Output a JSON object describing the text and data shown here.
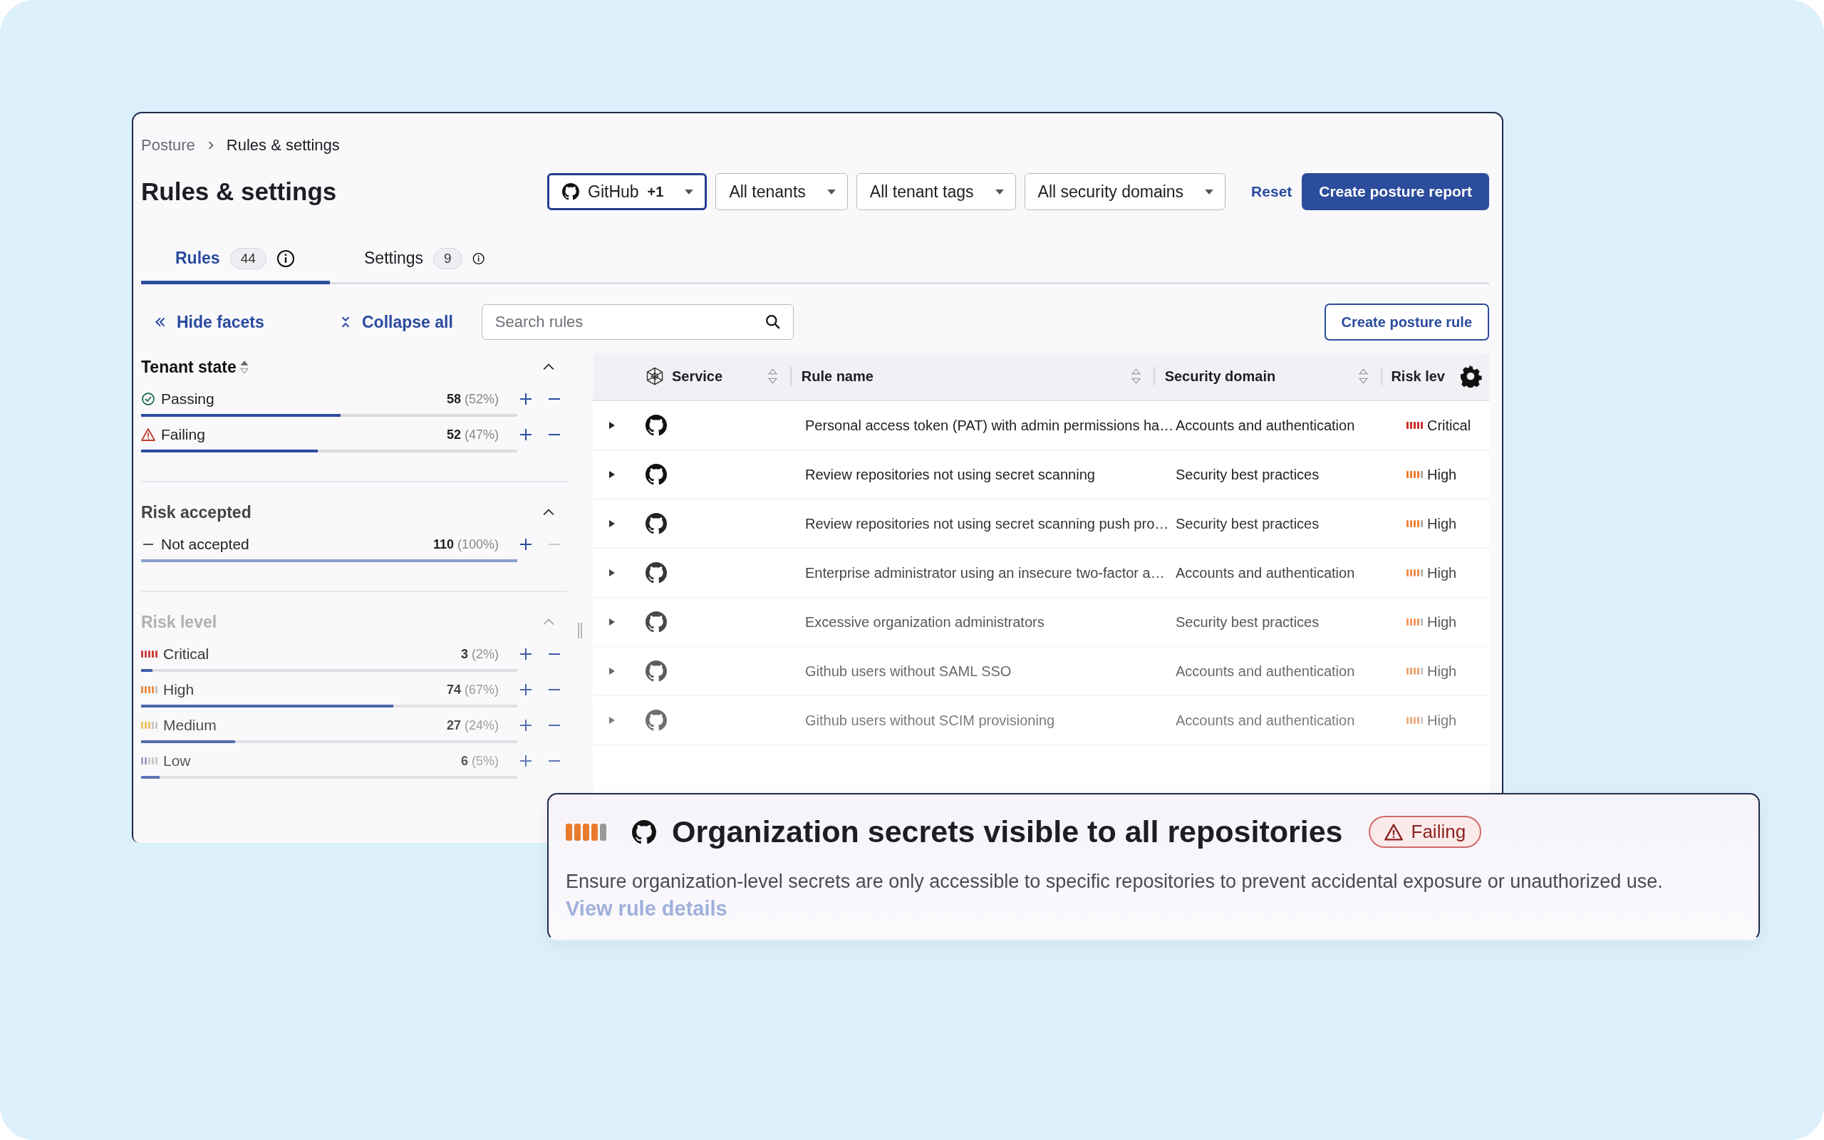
{
  "breadcrumb": [
    "Posture",
    "Rules & settings"
  ],
  "title": "Rules & settings",
  "filters": [
    {
      "label": "GitHub",
      "badge": "+1",
      "kind": "service",
      "selected": true
    },
    {
      "label": "All tenants",
      "kind": "plain",
      "selected": false
    },
    {
      "label": "All tenant tags",
      "kind": "plain",
      "selected": false
    },
    {
      "label": "All security domains",
      "kind": "plain",
      "selected": false
    }
  ],
  "reset": "Reset",
  "primary_button": "Create posture report",
  "tabs": [
    {
      "label": "Rules",
      "count": "44",
      "selected": true
    },
    {
      "label": "Settings",
      "count": "9",
      "selected": false
    }
  ],
  "toolbar": {
    "hide_facets": "Hide facets",
    "collapse_all": "Collapse all",
    "search": {
      "placeholder": "Search rules"
    },
    "create_rule": "Create posture rule"
  },
  "facets": [
    {
      "title": "Tenant state",
      "expanded": true,
      "items": [
        {
          "label": "Passing",
          "kind": "check",
          "count": "58",
          "pct": "(52%)",
          "level": 0.53,
          "exclude_disabled": false
        },
        {
          "label": "Failing",
          "kind": "warning",
          "count": "52",
          "pct": "(47%)",
          "level": 0.47,
          "exclude_disabled": false
        }
      ]
    },
    {
      "title": "Risk accepted",
      "expanded": true,
      "items": [
        {
          "label": "Not accepted",
          "kind": "dash",
          "count": "110",
          "pct": "(100%)",
          "level": 1,
          "exclude_disabled": true
        }
      ]
    },
    {
      "title": "Risk level",
      "expanded": true,
      "items": [
        {
          "label": "Critical",
          "kind": "critical",
          "count": "3",
          "pct": "(2%)",
          "level": 0.03,
          "exclude_disabled": false
        },
        {
          "label": "High",
          "kind": "high",
          "count": "74",
          "pct": "(67%)",
          "level": 0.67,
          "exclude_disabled": false
        },
        {
          "label": "Medium",
          "kind": "medium",
          "count": "27",
          "pct": "(24%)",
          "level": 0.25,
          "exclude_disabled": false
        },
        {
          "label": "Low",
          "kind": "low",
          "count": "6",
          "pct": "(5%)",
          "level": 0.05,
          "exclude_disabled": false
        }
      ]
    }
  ],
  "table": {
    "columns": [
      {
        "label": "Service",
        "sortable": true
      },
      {
        "label": "Rule name",
        "sortable": true
      },
      {
        "label": "Security domain",
        "sortable": true
      },
      {
        "label": "Risk lev",
        "sortable": false
      }
    ],
    "rows": [
      {
        "rule": "Personal access token (PAT) with admin permissions ha…",
        "domain": "Accounts and authentication",
        "risk": "Critical",
        "kind": "critical"
      },
      {
        "rule": "Review repositories not using secret scanning",
        "domain": "Security best practices",
        "risk": "High",
        "kind": "high"
      },
      {
        "rule": "Review repositories not using secret scanning push pro…",
        "domain": "Security best practices",
        "risk": "High",
        "kind": "high"
      },
      {
        "rule": "Enterprise administrator using an insecure two-factor a…",
        "domain": "Accounts and authentication",
        "risk": "High",
        "kind": "high"
      },
      {
        "rule": "Excessive organization administrators",
        "domain": "Security best practices",
        "risk": "High",
        "kind": "high"
      },
      {
        "rule": "Github users without SAML SSO",
        "domain": "Accounts and authentication",
        "risk": "High",
        "kind": "high"
      },
      {
        "rule": "Github users without SCIM provisioning",
        "domain": "Accounts and authentication",
        "risk": "High",
        "kind": "high"
      }
    ]
  },
  "detail": {
    "kind": "high",
    "title": "Organization secrets visible to all repositories",
    "status": {
      "label": "Failing",
      "kind": "failing"
    },
    "description": "Ensure organization-level secrets are only accessible to specific repositories to prevent accidental exposure or unauthorized use.",
    "link": "View rule details"
  }
}
